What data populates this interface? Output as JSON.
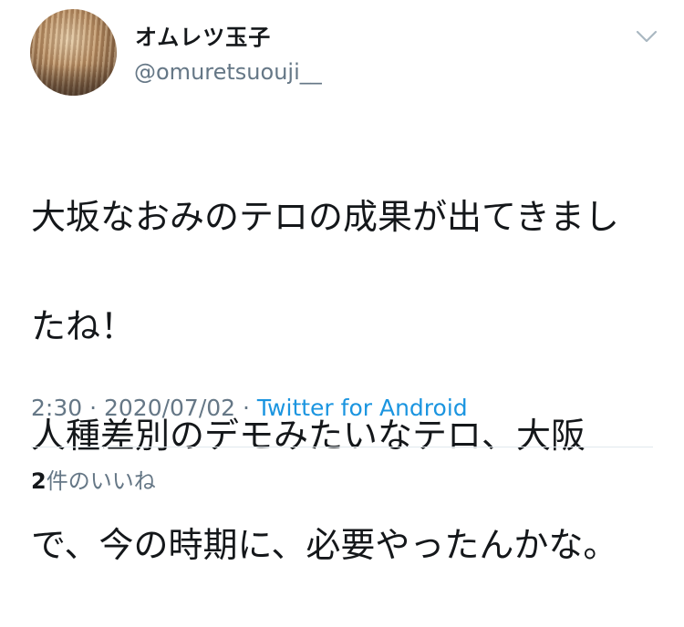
{
  "user": {
    "display_name": "オムレツ玉子",
    "handle": "@omuretsuouji__",
    "avatar_icon": "user-avatar-photo"
  },
  "menu": {
    "icon": "chevron-down-icon"
  },
  "tweet": {
    "lines": [
      "大坂なおみのテロの成果が出てきまし",
      "たね！",
      "人種差別のデモみたいなテロ、大阪",
      "で、今の時期に、必要やったんかな。"
    ]
  },
  "meta": {
    "time": "2:30",
    "separator": " · ",
    "date": "2020/07/02",
    "source": "Twitter for Android"
  },
  "stats": {
    "like_count": "2",
    "like_label": "件のいいね"
  },
  "colors": {
    "text": "#14171a",
    "secondary": "#657786",
    "link": "#1b95e0",
    "divider": "#e1e8ed"
  }
}
